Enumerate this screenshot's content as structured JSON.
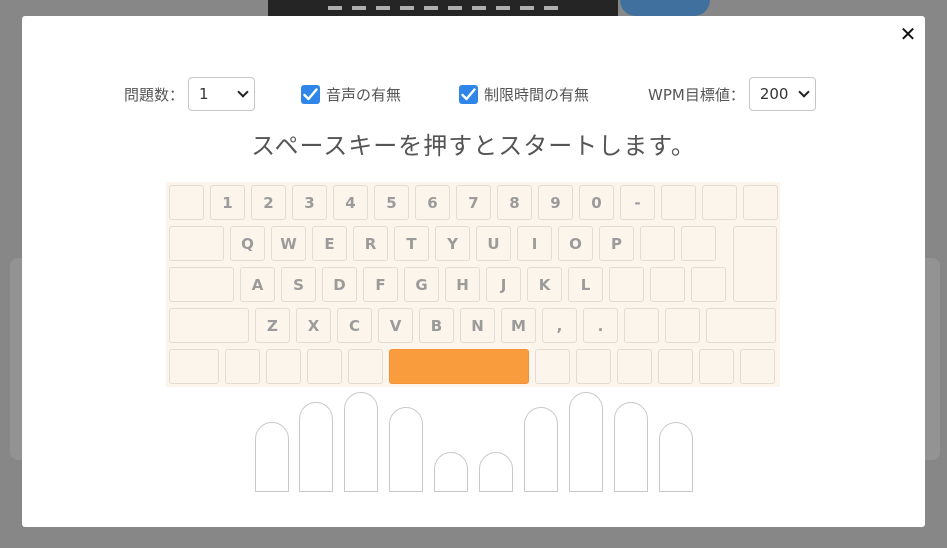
{
  "controls": {
    "question_count": {
      "label": "問題数：",
      "value": "1"
    },
    "voice": {
      "label": "音声の有無",
      "checked": true
    },
    "time_limit": {
      "label": "制限時間の有無",
      "checked": true
    },
    "wpm_target": {
      "label": "WPM目標値：",
      "value": "200"
    }
  },
  "instruction": "スペースキーを押すとスタートします。",
  "close_icon": "close-icon",
  "colors": {
    "accent": "#2f86e8",
    "space_key": "#f89c3d",
    "keyboard_bg": "#fcf5ec"
  },
  "keyboard": {
    "rows": [
      [
        "",
        "1",
        "2",
        "3",
        "4",
        "5",
        "6",
        "7",
        "8",
        "9",
        "0",
        "-",
        "",
        "",
        ""
      ],
      [
        "",
        "Q",
        "W",
        "E",
        "R",
        "T",
        "Y",
        "U",
        "I",
        "O",
        "P",
        "",
        "",
        ""
      ],
      [
        "",
        "A",
        "S",
        "D",
        "F",
        "G",
        "H",
        "J",
        "K",
        "L",
        "",
        "",
        ""
      ],
      [
        "",
        "Z",
        "X",
        "C",
        "V",
        "B",
        "N",
        "M",
        ",",
        ".",
        "",
        "",
        ""
      ],
      [
        "",
        "",
        "",
        "",
        "",
        "",
        "",
        "",
        "",
        "",
        "",
        ""
      ]
    ],
    "highlighted_key": "space"
  }
}
